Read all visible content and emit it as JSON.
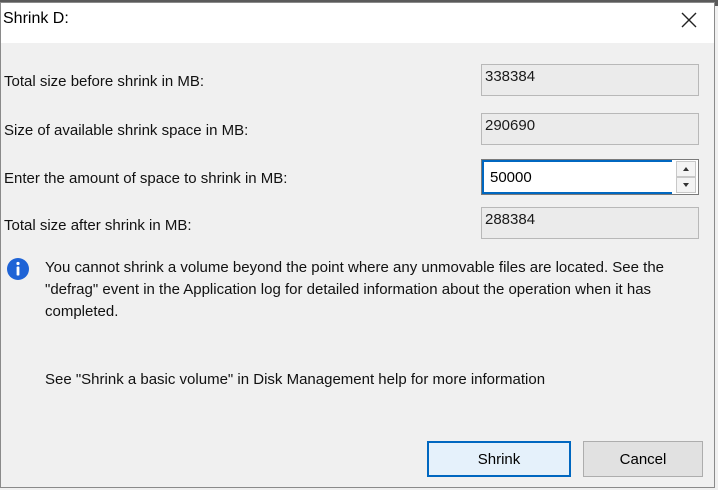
{
  "dialog": {
    "title": "Shrink D:",
    "close_icon": "close-icon"
  },
  "fields": {
    "total_before_label": "Total size before shrink in MB:",
    "total_before_value": "338384",
    "available_label": "Size of available shrink space in MB:",
    "available_value": "290690",
    "amount_label": "Enter the amount of space to shrink in MB:",
    "amount_value": "50000",
    "total_after_label": "Total size after shrink in MB:",
    "total_after_value": "288384"
  },
  "info": {
    "icon": "info-icon",
    "text": "You cannot shrink a volume beyond the point where any unmovable files are located. See the \"defrag\" event in the Application log for detailed information about the operation when it has completed.",
    "help": "See \"Shrink a basic volume\" in Disk Management help for more information"
  },
  "buttons": {
    "shrink": "Shrink",
    "cancel": "Cancel"
  },
  "colors": {
    "accent": "#0067c0",
    "info_icon": "#1e63d6"
  }
}
